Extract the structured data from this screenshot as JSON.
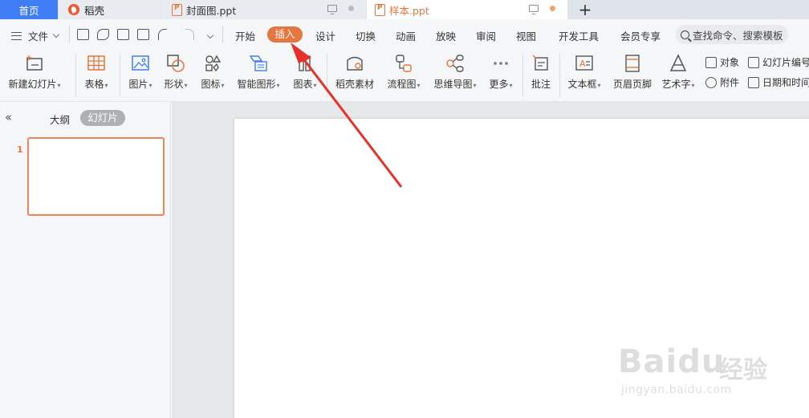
{
  "tabs": {
    "home": "首页",
    "daoke": "稻壳",
    "file1": "封面图.ppt",
    "file2": "样本.ppt",
    "add": "+"
  },
  "menu": {
    "file": "文件",
    "tabs": [
      "开始",
      "插入",
      "设计",
      "切换",
      "动画",
      "放映",
      "审阅",
      "视图",
      "开发工具",
      "会员专享"
    ],
    "active_tab": "插入",
    "search_placeholder": "查找命令、搜索模板"
  },
  "ribbon": {
    "new_slide": "新建幻灯片",
    "table": "表格",
    "picture": "图片",
    "shape": "形状",
    "icon": "图标",
    "smart_art": "智能图形",
    "chart": "图表",
    "daoke_material": "稻壳素材",
    "flowchart": "流程图",
    "mindmap": "思维导图",
    "more": "更多",
    "comment": "批注",
    "textbox": "文本框",
    "header_footer": "页眉页脚",
    "wordart": "艺术字",
    "object": "对象",
    "attachment": "附件",
    "slide_number": "幻灯片编号",
    "datetime": "日期和时间"
  },
  "left_panel": {
    "outline_tab": "大纲",
    "slides_tab": "幻灯片",
    "slide_number": "1"
  },
  "watermark": {
    "brand": "Bai",
    "brand2": "du",
    "cn": "经验",
    "url": "jingyan.baidu.com"
  },
  "colors": {
    "accent": "#e5763f",
    "home_tab": "#3f7ef4",
    "arrow": "#e8302b"
  }
}
